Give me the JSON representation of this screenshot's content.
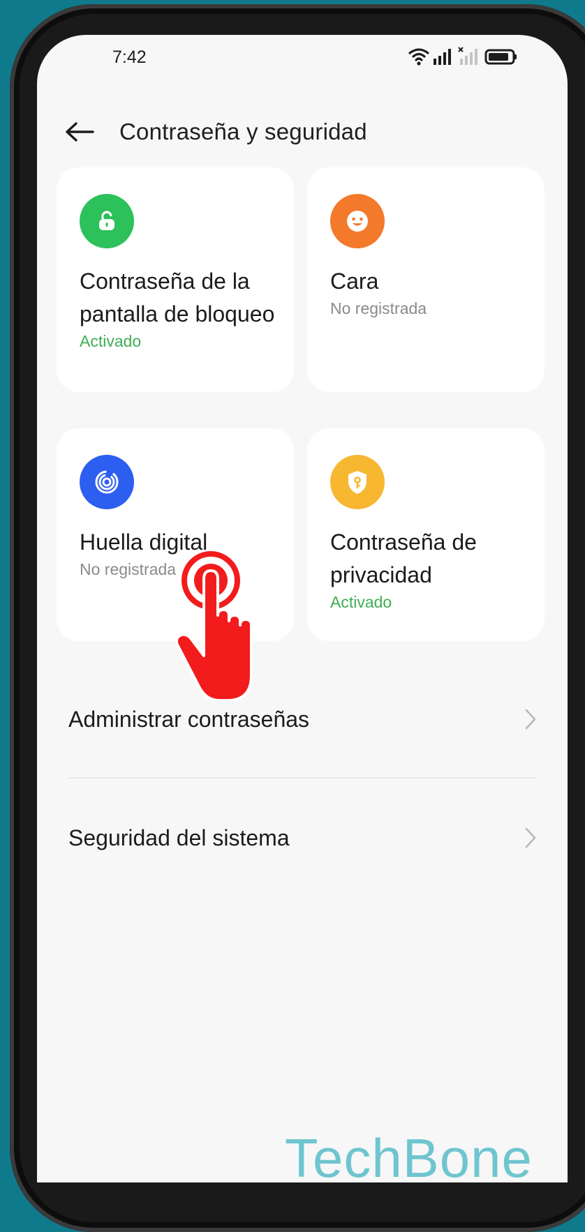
{
  "status_bar": {
    "time": "7:42"
  },
  "header": {
    "title": "Contraseña y seguridad"
  },
  "cards": [
    {
      "title": "Contraseña de la pantalla de bloqueo",
      "status": "Activado",
      "status_color": "#3fae55",
      "icon": "lock-icon",
      "icon_color": "#2cc15a"
    },
    {
      "title": "Cara",
      "status": "No registrada",
      "status_color": "#8a8a8a",
      "icon": "face-icon",
      "icon_color": "#f27a2a"
    },
    {
      "title": "Huella digital",
      "status": "No registrada",
      "status_color": "#8a8a8a",
      "icon": "fingerprint-icon",
      "icon_color": "#2c5ef0"
    },
    {
      "title": "Contraseña de privacidad",
      "status": "Activado",
      "status_color": "#3fae55",
      "icon": "shield-key-icon",
      "icon_color": "#f7b731"
    }
  ],
  "menu": [
    {
      "label": "Administrar contraseñas"
    },
    {
      "label": "Seguridad del sistema"
    }
  ],
  "watermark": "TechBone",
  "colors": {
    "accent_green": "#3fae55",
    "tap_indicator": "#f21c1c",
    "background": "#0f7a8c"
  }
}
